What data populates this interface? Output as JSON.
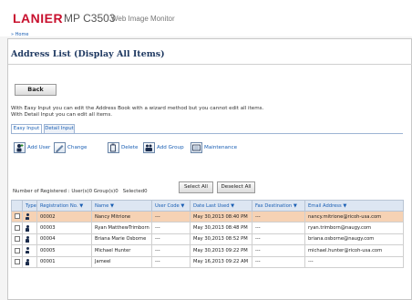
{
  "header": {
    "brand": "LANIER",
    "model": "MP C3503",
    "product": "Web Image Monitor",
    "home_link": "» Home"
  },
  "page": {
    "title": "Address List (Display All Items)",
    "back_label": "Back",
    "info_easy": "With Easy Input you can edit the Address Book with a wizard method but you cannot edit all items.",
    "info_detail": "With Detail Input you can edit all items."
  },
  "tabs": [
    "Easy Input",
    "Detail Input"
  ],
  "toolbar": {
    "add_user": "Add User",
    "change": "Change",
    "delete": "Delete",
    "add_group": "Add Group",
    "maintenance": "Maintenance"
  },
  "registered": {
    "label": "Number of Registered : User(s)0 Group(s)0",
    "selected": "Selected0"
  },
  "buttons": {
    "select_all": "Select All",
    "deselect_all": "Deselect All"
  },
  "table": {
    "columns": [
      "",
      "Type ▼",
      "Registration No. ▼",
      "Name ▼",
      "User Code ▼",
      "Date Last Used ▼",
      "Fax Destination ▼",
      "Email Address ▼"
    ],
    "rows": [
      {
        "selected": true,
        "reg": "00002",
        "name": "Nancy Mitrione",
        "code": "---",
        "date": "May 30,2013 08:40 PM",
        "fax": "---",
        "email": "nancy.mitrione@ricoh-usa.com"
      },
      {
        "selected": false,
        "reg": "00003",
        "name": "Ryan MatthewTrimborn",
        "code": "---",
        "date": "May 30,2013 08:48 PM",
        "fax": "---",
        "email": "ryan.trimborn@naugy.com"
      },
      {
        "selected": false,
        "reg": "00004",
        "name": "Briana Marie Osborne",
        "code": "---",
        "date": "May 30,2013 08:52 PM",
        "fax": "---",
        "email": "briana.osborne@naugy.com"
      },
      {
        "selected": false,
        "reg": "00005",
        "name": "Michael Hunter",
        "code": "---",
        "date": "May 30,2013 09:22 PM",
        "fax": "---",
        "email": "michael.hunter@ricoh-usa.com"
      },
      {
        "selected": false,
        "reg": "00001",
        "name": "Jameel",
        "code": "---",
        "date": "May 16,2013 09:22 AM",
        "fax": "---",
        "email": "---"
      }
    ]
  },
  "colors": {
    "brand": "#c8102e",
    "title": "#203a62",
    "link": "#1a5fb4",
    "header_row": "#dde6f2",
    "selected_row": "#f6d2b4"
  },
  "icons": [
    "add-user-icon",
    "change-icon",
    "delete-icon",
    "add-group-icon",
    "maintenance-icon",
    "user-type-icon"
  ]
}
